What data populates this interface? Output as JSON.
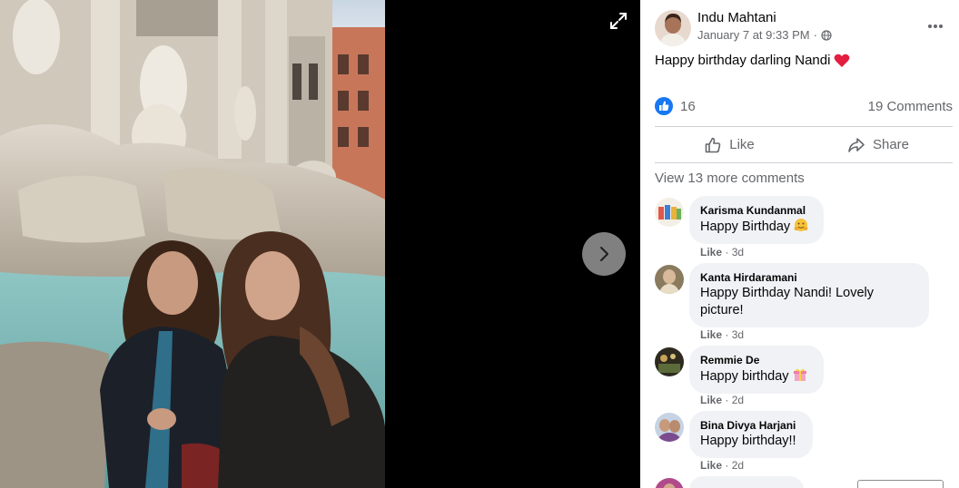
{
  "viewer": {
    "expand_icon": "expand-icon",
    "next_icon": "chevron-right-icon"
  },
  "post": {
    "author": "Indu Mahtani",
    "timestamp": "January 7 at 9:33 PM",
    "separator": "·",
    "privacy_icon": "globe-icon",
    "more_icon": "more-horizontal-icon",
    "text": "Happy birthday darling Nandi",
    "text_emoji": "heart",
    "reaction_count": "16",
    "comment_count": "19 Comments",
    "like_label": "Like",
    "share_label": "Share",
    "view_more_label": "View 13 more comments"
  },
  "comments": [
    {
      "author": "Karisma Kundanmal",
      "text": "Happy Birthday",
      "emoji": "hugging-face",
      "like_label": "Like",
      "separator": "·",
      "age": "3d"
    },
    {
      "author": "Kanta Hirdaramani",
      "text_line1": "Happy Birthday Nandi! Lovely",
      "text_line2": "picture!",
      "like_label": "Like",
      "separator": "·",
      "age": "3d"
    },
    {
      "author": "Remmie De",
      "text": "Happy birthday",
      "emoji": "gift",
      "like_label": "Like",
      "separator": "·",
      "age": "2d"
    },
    {
      "author": "Bina Divya Harjani",
      "text": "Happy birthday!!",
      "like_label": "Like",
      "separator": "·",
      "age": "2d"
    }
  ],
  "colors": {
    "facebook_blue": "#1877f2",
    "heart_red": "#e41e3f",
    "secondary_text": "#65676b",
    "bubble_bg": "#f0f2f5"
  }
}
